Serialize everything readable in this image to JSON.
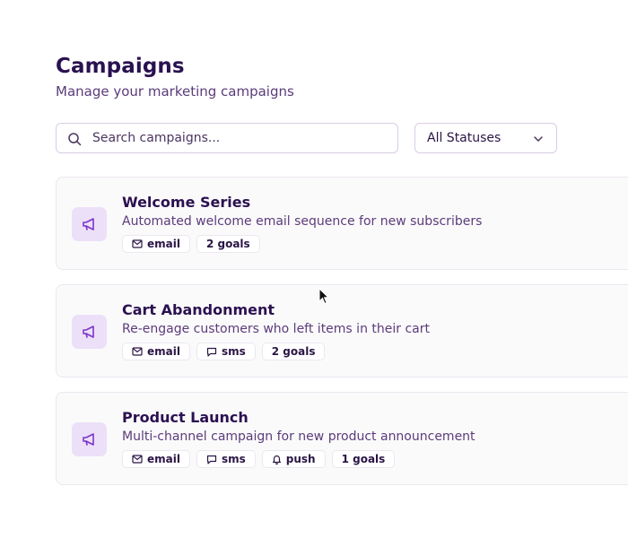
{
  "header": {
    "title": "Campaigns",
    "subtitle": "Manage your marketing campaigns"
  },
  "search": {
    "placeholder": "Search campaigns...",
    "value": "",
    "icon": "search-icon"
  },
  "status_filter": {
    "selected": "All Statuses",
    "icon": "chevron-down-icon"
  },
  "campaigns": [
    {
      "title": "Welcome Series",
      "description": "Automated welcome email sequence for new subscribers",
      "icon": "megaphone-icon",
      "tags": [
        {
          "label": "email",
          "icon": "mail-icon"
        },
        {
          "label": "2 goals",
          "icon": ""
        }
      ]
    },
    {
      "title": "Cart Abandonment",
      "description": "Re-engage customers who left items in their cart",
      "icon": "megaphone-icon",
      "tags": [
        {
          "label": "email",
          "icon": "mail-icon"
        },
        {
          "label": "sms",
          "icon": "message-icon"
        },
        {
          "label": "2 goals",
          "icon": ""
        }
      ]
    },
    {
      "title": "Product Launch",
      "description": "Multi-channel campaign for new product announcement",
      "icon": "megaphone-icon",
      "tags": [
        {
          "label": "email",
          "icon": "mail-icon"
        },
        {
          "label": "sms",
          "icon": "message-icon"
        },
        {
          "label": "push",
          "icon": "bell-icon"
        },
        {
          "label": "1 goals",
          "icon": ""
        }
      ]
    }
  ],
  "colors": {
    "accent": "#7b35c9",
    "icon_bg": "#ece0f8",
    "title": "#2a1150",
    "text_secondary": "#5b3c7a"
  }
}
